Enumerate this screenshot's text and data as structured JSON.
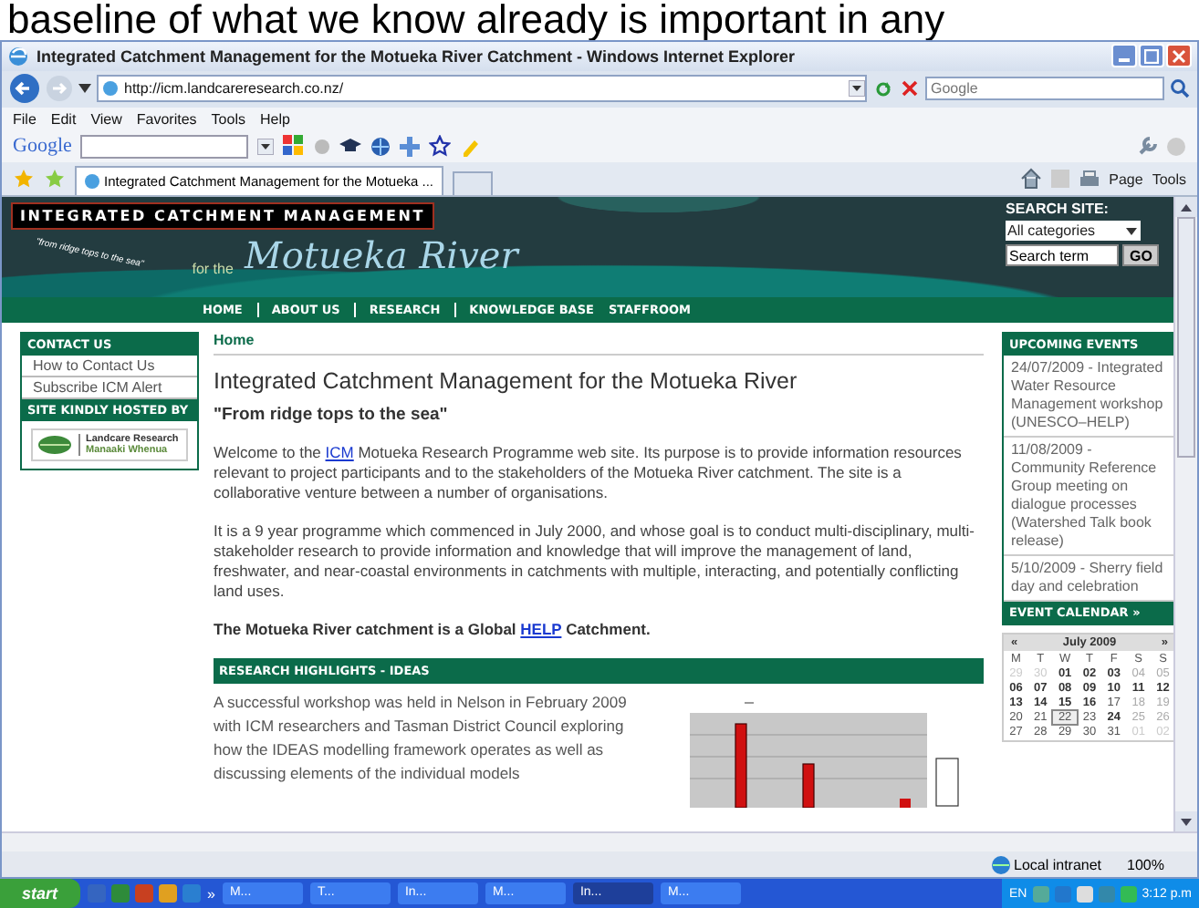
{
  "caption": {
    "text": "baseline of what we know already is important in any"
  },
  "window": {
    "title": "Integrated Catchment Management for the Motueka River Catchment - Windows Internet Explorer"
  },
  "address_bar": {
    "url": "http://icm.landcareresearch.co.nz/",
    "search_placeholder": "Google"
  },
  "menu": [
    "File",
    "Edit",
    "View",
    "Favorites",
    "Tools",
    "Help"
  ],
  "google_toolbar": {
    "logo": "Google"
  },
  "tabs": [
    {
      "label": "Integrated Catchment Management for the Motueka ...",
      "selected": true
    }
  ],
  "command_bar": [
    "Page",
    "Tools"
  ],
  "page": {
    "banner": {
      "title": "INTEGRATED CATCHMENT MANAGEMENT",
      "tagline": "\"from ridge tops to the sea\"",
      "for_the": "for the",
      "river": "Motueka River"
    },
    "search": {
      "label": "SEARCH SITE:",
      "category": "All categories",
      "term": "Search term",
      "button": "GO"
    },
    "nav": [
      {
        "label": "HOME",
        "divider_before": false
      },
      {
        "label": "ABOUT US",
        "divider_before": true
      },
      {
        "label": "RESEARCH",
        "divider_before": true
      },
      {
        "label": "KNOWLEDGE BASE",
        "divider_before": true
      },
      {
        "label": "STAFFROOM",
        "divider_before": false
      }
    ],
    "sidebar": {
      "contact_heading": "CONTACT US",
      "contact_items": [
        "How to Contact Us",
        "Subscribe ICM Alert"
      ],
      "host_heading": "SITE KINDLY HOSTED BY",
      "host_logo": {
        "name": "Landcare Research",
        "subtitle": "Manaaki Whenua"
      }
    },
    "main": {
      "breadcrumb": "Home",
      "title": "Integrated Catchment Management for the Motueka River",
      "subtitle": "\"From ridge tops to the sea\"",
      "welcome": {
        "before": "Welcome to the ",
        "link": "ICM",
        "after": " Motueka Research Programme web site. Its purpose is to provide information resources relevant to project participants and to the stakeholders of the Motueka River catchment. The site is a collaborative venture between a number of organisations."
      },
      "programme": "It is a 9 year programme which commenced in July 2000, and whose goal is to conduct multi-disciplinary, multi-stakeholder research to provide information and knowledge that will improve the management of land, freshwater, and near-coastal environments in catchments with multiple, interacting, and potentially conflicting land uses.",
      "help_line": {
        "before": "The Motueka River catchment is a Global ",
        "link": "HELP",
        "after": " Catchment."
      },
      "highlights_heading": "RESEARCH HIGHLIGHTS - IDEAS",
      "highlights_text": "A successful workshop was held in Nelson in February 2009 with ICM researchers and Tasman District Council exploring how the IDEAS modelling framework operates as well as discussing elements of the individual models"
    },
    "events": {
      "heading": "UPCOMING EVENTS",
      "items": [
        "24/07/2009 - Integrated Water Resource Management workshop (UNESCO–HELP)",
        "11/08/2009 - Community Reference Group meeting on dialogue processes (Watershed Talk book release)",
        "5/10/2009 - Sherry field day and celebration"
      ],
      "calendar_heading": "EVENT CALENDAR »"
    },
    "calendar": {
      "prev": "«",
      "month": "July 2009",
      "next": "»",
      "weekdays": [
        "M",
        "T",
        "W",
        "T",
        "F",
        "S",
        "S"
      ],
      "weeks": [
        [
          {
            "day": "29",
            "kind": "other",
            "selected": false
          },
          {
            "day": "30",
            "kind": "other",
            "selected": false
          },
          {
            "day": "01",
            "kind": "event",
            "selected": false
          },
          {
            "day": "02",
            "kind": "event",
            "selected": false
          },
          {
            "day": "03",
            "kind": "event",
            "selected": false
          },
          {
            "day": "04",
            "kind": "weekend",
            "selected": false
          },
          {
            "day": "05",
            "kind": "weekend",
            "selected": false
          }
        ],
        [
          {
            "day": "06",
            "kind": "event",
            "selected": false
          },
          {
            "day": "07",
            "kind": "event",
            "selected": false
          },
          {
            "day": "08",
            "kind": "event",
            "selected": false
          },
          {
            "day": "09",
            "kind": "event",
            "selected": false
          },
          {
            "day": "10",
            "kind": "event",
            "selected": false
          },
          {
            "day": "11",
            "kind": "event",
            "selected": false
          },
          {
            "day": "12",
            "kind": "event",
            "selected": false
          }
        ],
        [
          {
            "day": "13",
            "kind": "event",
            "selected": false
          },
          {
            "day": "14",
            "kind": "event",
            "selected": false
          },
          {
            "day": "15",
            "kind": "event",
            "selected": false
          },
          {
            "day": "16",
            "kind": "event",
            "selected": false
          },
          {
            "day": "17",
            "kind": "plain",
            "selected": false
          },
          {
            "day": "18",
            "kind": "weekend",
            "selected": false
          },
          {
            "day": "19",
            "kind": "weekend",
            "selected": false
          }
        ],
        [
          {
            "day": "20",
            "kind": "plain",
            "selected": false
          },
          {
            "day": "21",
            "kind": "plain",
            "selected": false
          },
          {
            "day": "22",
            "kind": "plain",
            "selected": true
          },
          {
            "day": "23",
            "kind": "plain",
            "selected": false
          },
          {
            "day": "24",
            "kind": "event",
            "selected": false
          },
          {
            "day": "25",
            "kind": "weekend",
            "selected": false
          },
          {
            "day": "26",
            "kind": "weekend",
            "selected": false
          }
        ],
        [
          {
            "day": "27",
            "kind": "plain",
            "selected": false
          },
          {
            "day": "28",
            "kind": "plain",
            "selected": false
          },
          {
            "day": "29",
            "kind": "plain",
            "selected": false
          },
          {
            "day": "30",
            "kind": "plain",
            "selected": false
          },
          {
            "day": "31",
            "kind": "plain",
            "selected": false
          },
          {
            "day": "01",
            "kind": "other",
            "selected": false
          },
          {
            "day": "02",
            "kind": "other",
            "selected": false
          }
        ]
      ]
    }
  },
  "status_bar": {
    "zone": "Local intranet",
    "zoom": "100%"
  },
  "taskbar": {
    "start": "start",
    "more": "»",
    "tasks": [
      {
        "label": "M...",
        "selected": false
      },
      {
        "label": "T...",
        "selected": false
      },
      {
        "label": "In...",
        "selected": false
      },
      {
        "label": "M...",
        "selected": false
      },
      {
        "label": "In...",
        "selected": true
      },
      {
        "label": "M...",
        "selected": false
      }
    ],
    "language": "EN",
    "clock": "3:12 p.m"
  }
}
